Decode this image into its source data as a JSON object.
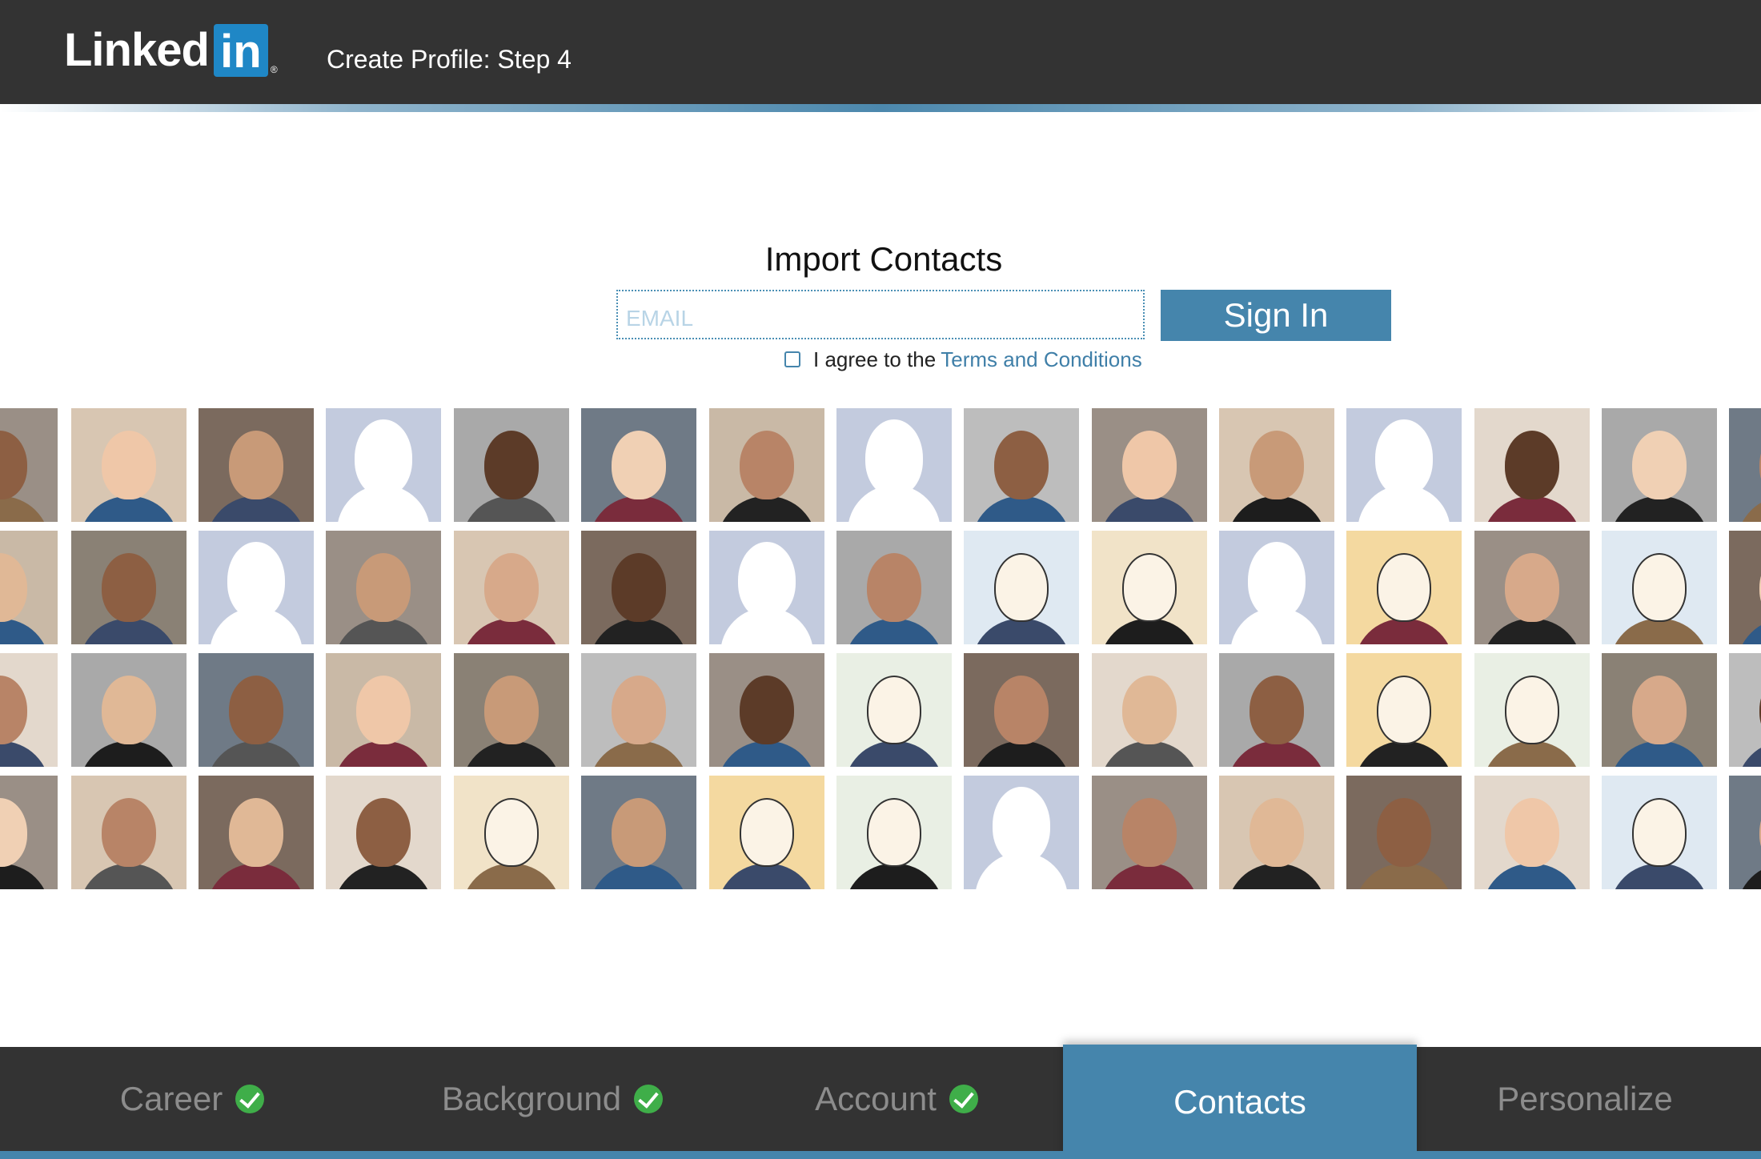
{
  "header": {
    "logo_text": "Linked",
    "logo_in": "in",
    "logo_reg": "®",
    "step_title": "Create Profile: Step 4"
  },
  "import": {
    "title": "Import Contacts",
    "email_placeholder": "EMAIL",
    "signin_label": "Sign In",
    "agree_text": "I agree to the",
    "terms_link": "Terms and Conditions"
  },
  "nav": {
    "tabs": [
      {
        "label": "Career",
        "completed": true
      },
      {
        "label": "Background",
        "completed": true
      },
      {
        "label": "Account",
        "completed": true
      },
      {
        "label": "Contacts",
        "active": true
      },
      {
        "label": "Personalize"
      }
    ]
  },
  "colors": {
    "header_bg": "#333333",
    "accent": "#4585ac",
    "link": "#3f7fa8",
    "check": "#3fae49",
    "silhouette_bg": "#c3cbde"
  },
  "photo_grid": {
    "rows": [
      [
        "photo",
        "photo",
        "photo",
        "silhouette",
        "photo",
        "photo",
        "photo",
        "silhouette",
        "photo",
        "photo",
        "photo",
        "silhouette",
        "photo",
        "photo",
        "photo"
      ],
      [
        "photo",
        "photo",
        "silhouette",
        "photo",
        "photo",
        "photo",
        "silhouette",
        "photo",
        "illustration",
        "illustration",
        "silhouette",
        "illustration",
        "photo",
        "illustration",
        "photo"
      ],
      [
        "photo",
        "photo",
        "photo",
        "photo",
        "photo",
        "photo",
        "photo",
        "illustration",
        "photo",
        "photo",
        "photo",
        "illustration",
        "illustration",
        "photo",
        "photo"
      ],
      [
        "photo",
        "photo",
        "photo",
        "photo",
        "illustration",
        "photo",
        "illustration",
        "illustration",
        "silhouette",
        "photo",
        "photo",
        "photo",
        "photo",
        "illustration",
        "photo"
      ]
    ]
  }
}
